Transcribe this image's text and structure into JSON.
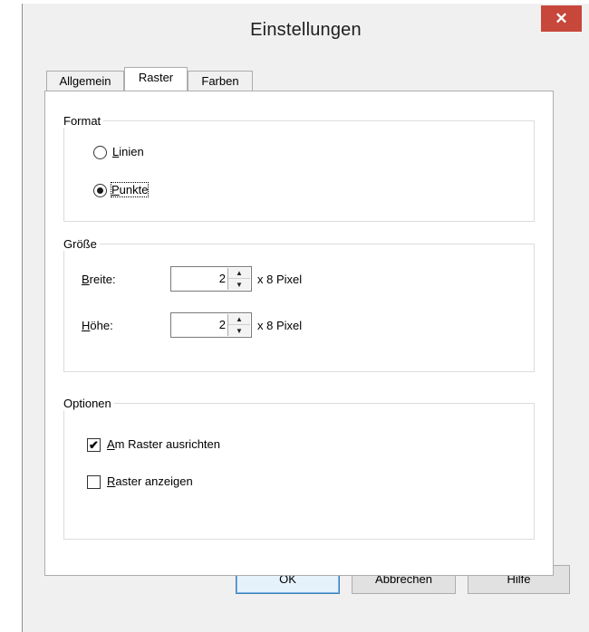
{
  "window": {
    "title": "Einstellungen",
    "close_glyph": "✕"
  },
  "tabs": [
    {
      "label": "Allgemein",
      "active": false
    },
    {
      "label": "Raster",
      "active": true
    },
    {
      "label": "Farben",
      "active": false
    }
  ],
  "format": {
    "legend": "Format",
    "options": [
      {
        "accel": "L",
        "rest": "inien",
        "selected": false
      },
      {
        "accel": "P",
        "rest": "unkte",
        "selected": true
      }
    ]
  },
  "size": {
    "legend": "Größe",
    "width": {
      "accel": "B",
      "rest": "reite:",
      "value": "2",
      "unit": "x 8 Pixel"
    },
    "height": {
      "accel": "H",
      "rest": "öhe:",
      "value": "2",
      "unit": "x 8 Pixel"
    }
  },
  "options": {
    "legend": "Optionen",
    "snap": {
      "accel": "A",
      "rest": "m Raster ausrichten",
      "checked": true,
      "check_glyph": "✔"
    },
    "show": {
      "accel": "R",
      "rest": "aster anzeigen",
      "checked": false
    }
  },
  "buttons": {
    "ok": "OK",
    "cancel": "Abbrechen",
    "help": "Hilfe"
  },
  "icons": {
    "spin_up": "▲",
    "spin_down": "▼"
  },
  "colors": {
    "close_button": "#c7473b",
    "dialog_bg": "#f0f0f0",
    "panel_bg": "#ffffff"
  }
}
